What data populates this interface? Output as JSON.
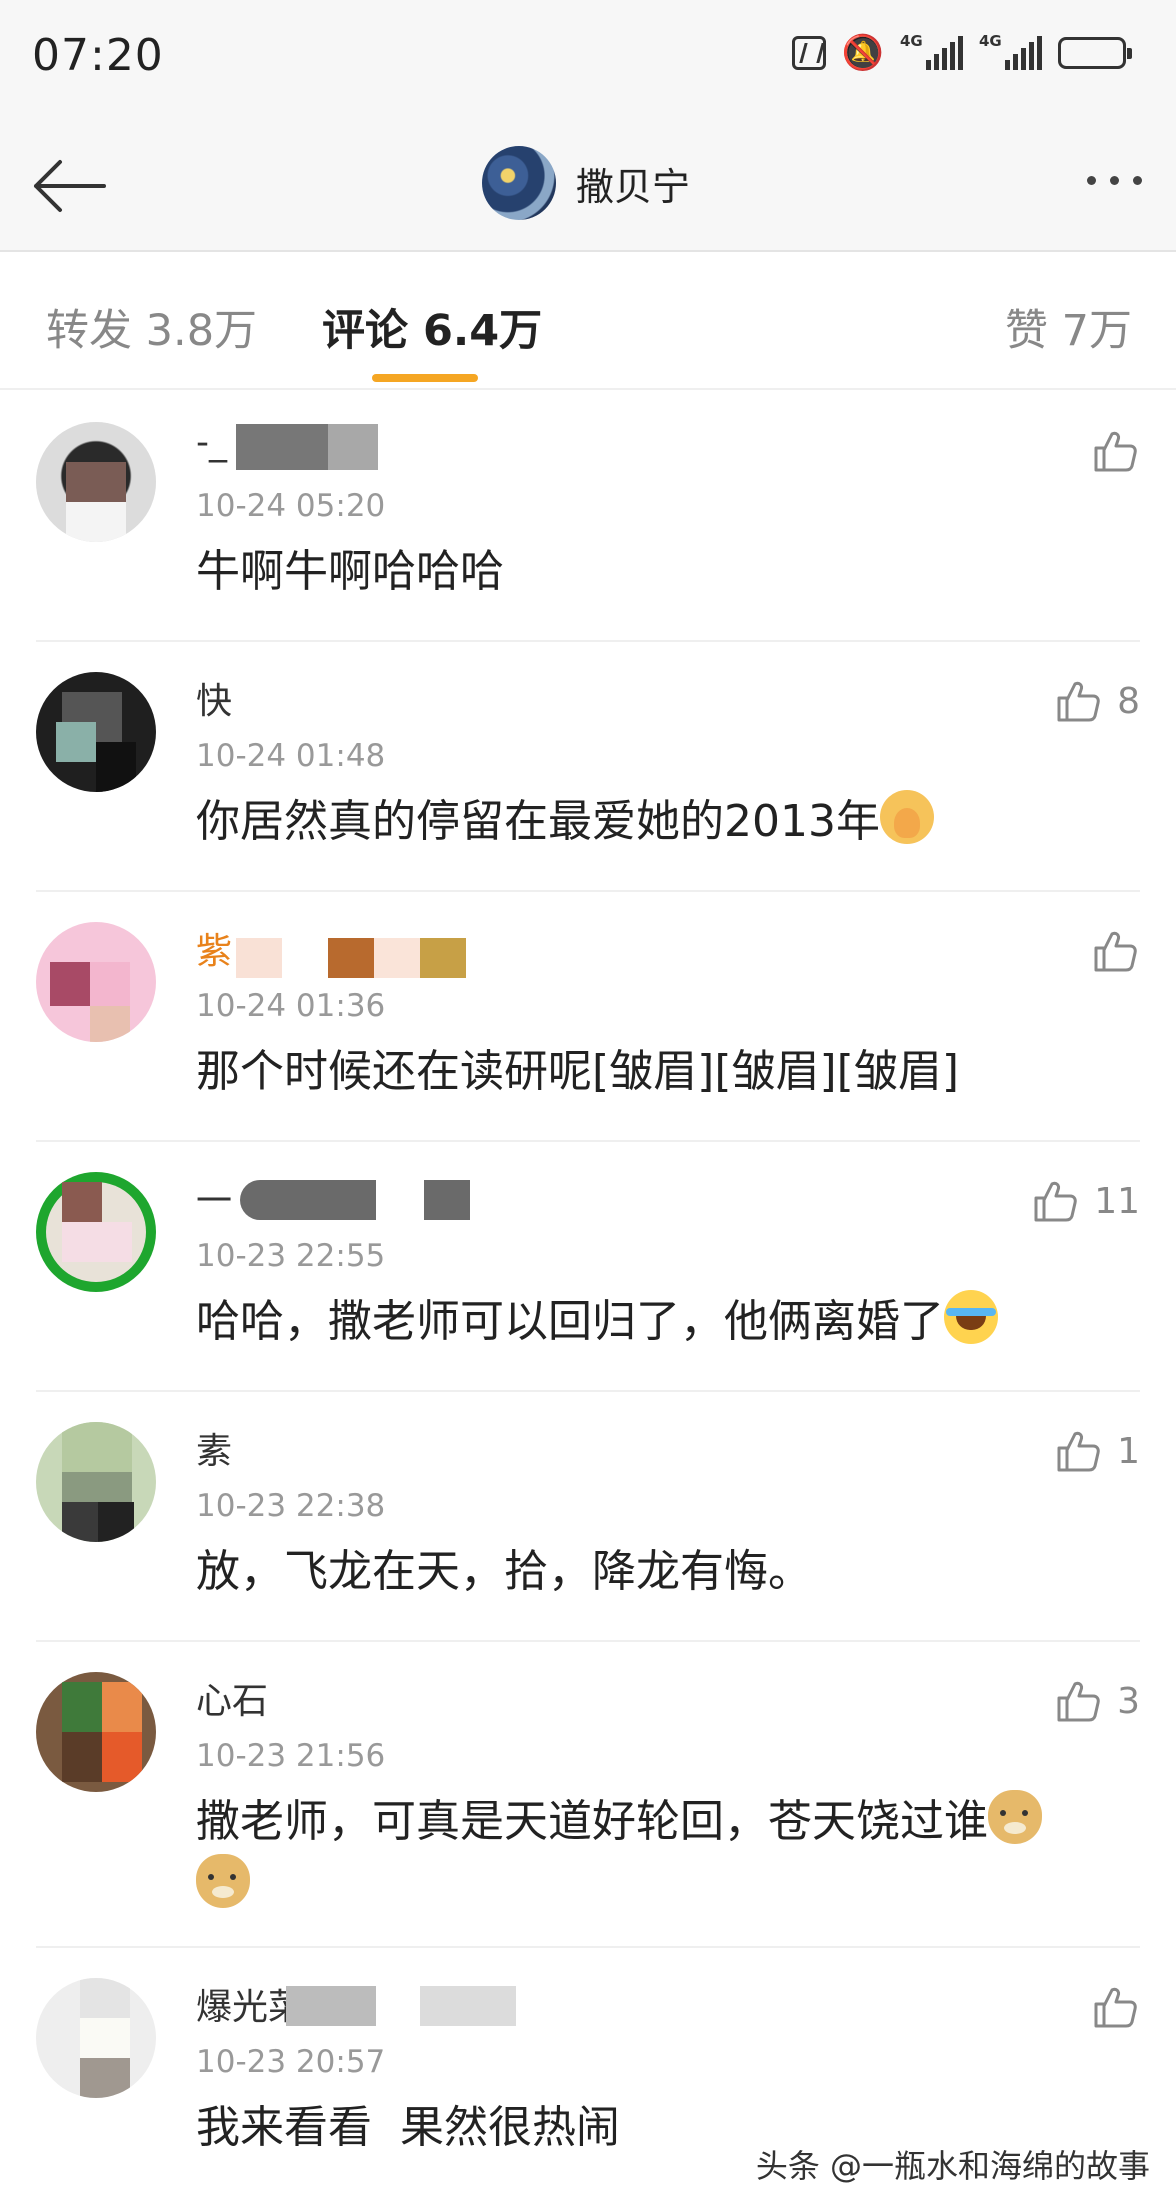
{
  "status_bar": {
    "time": "07:20",
    "signal_label_1": "4G",
    "signal_label_2": "4G"
  },
  "header": {
    "title": "撒贝宁"
  },
  "tabs": [
    {
      "label": "转发 3.8万"
    },
    {
      "label": "评论 6.4万"
    },
    {
      "label": "赞 7万"
    }
  ],
  "comments": [
    {
      "username": "-_",
      "time": "10-24 05:20",
      "text": "牛啊牛啊哈哈哈",
      "likes": ""
    },
    {
      "username": "快",
      "time": "10-24 01:48",
      "text": "你居然真的停留在最爱她的2013年",
      "likes": "8",
      "emoji": "pray-emoji"
    },
    {
      "username": "紫",
      "time": "10-24 01:36",
      "text": "那个时候还在读研呢[皱眉][皱眉][皱眉]",
      "likes": ""
    },
    {
      "username": "一",
      "time": "10-23 22:55",
      "text": "哈哈，撒老师可以回归了，他俩离婚了",
      "likes": "11",
      "emoji": "laugh-cry-emoji"
    },
    {
      "username": "素",
      "time": "10-23 22:38",
      "text": "放，飞龙在天，拾，降龙有悔。",
      "likes": "1"
    },
    {
      "username": "心石",
      "time": "10-23 21:56",
      "text": "撒老师，可真是天道好轮回，苍天饶过谁",
      "likes": "3",
      "emoji": "doge-emoji"
    },
    {
      "username": "爆光菜味",
      "time": "10-23 20:57",
      "text": "我来看看  果然很热闹",
      "likes": ""
    }
  ],
  "watermark": "头条 @一瓶水和海绵的故事",
  "colors": {
    "accent": "#f5a623",
    "vip_name": "#e8821b",
    "meta": "#999999"
  }
}
